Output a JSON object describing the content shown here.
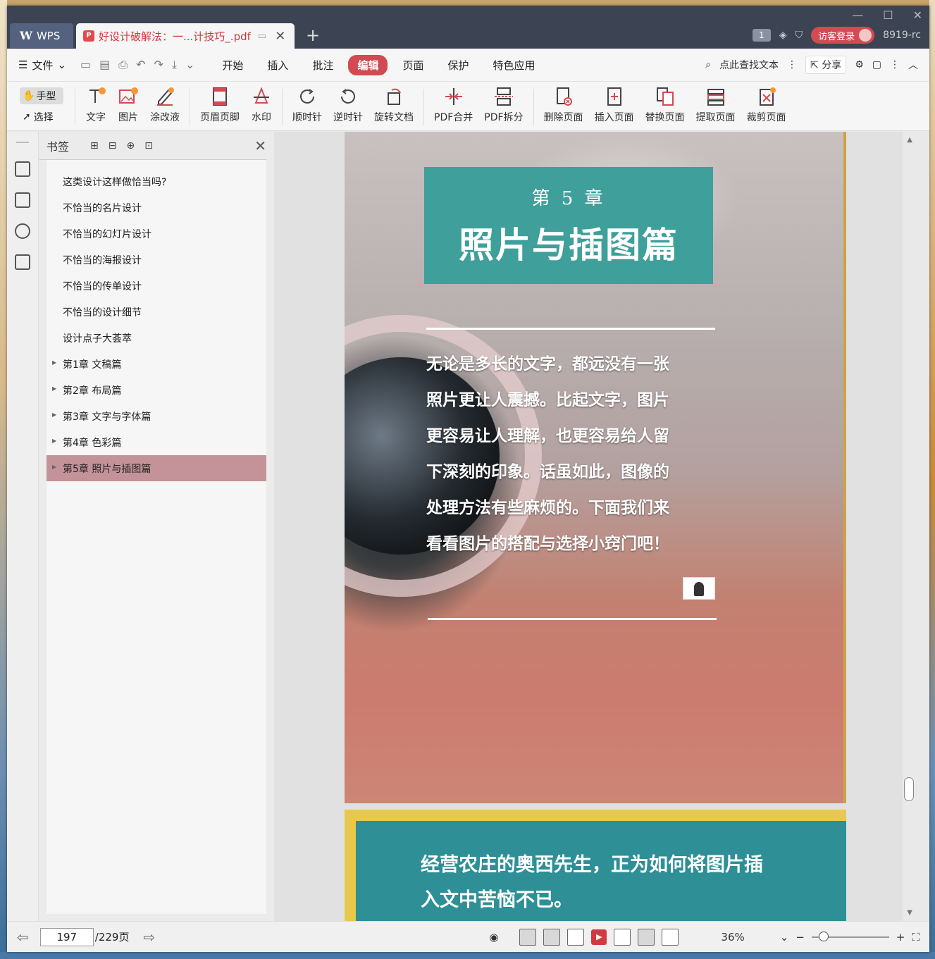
{
  "titlebar": {
    "app_tab": "WPS",
    "doc_tab": "好设计破解法：一...计技巧_.pdf",
    "login": "访客登录",
    "user_id": "8919-rc",
    "window_count": "1"
  },
  "menubar": {
    "file": "文件",
    "tabs": [
      "开始",
      "插入",
      "批注",
      "编辑",
      "页面",
      "保护",
      "特色应用"
    ],
    "active_tab": "编辑",
    "search": "点此查找文本",
    "share": "分享"
  },
  "ribbon": {
    "hand": "手型",
    "select": "选择",
    "tools": [
      "文字",
      "图片",
      "涂改液",
      "页眉页脚",
      "水印",
      "顺时针",
      "逆时针",
      "旋转文档",
      "PDF合并",
      "PDF拆分",
      "删除页面",
      "插入页面",
      "替换页面",
      "提取页面",
      "裁剪页面"
    ]
  },
  "bookmarks": {
    "title": "书签",
    "items": [
      {
        "label": "这类设计这样做恰当吗?",
        "expandable": false
      },
      {
        "label": "不恰当的名片设计",
        "expandable": false
      },
      {
        "label": "不恰当的幻灯片设计",
        "expandable": false
      },
      {
        "label": "不恰当的海报设计",
        "expandable": false
      },
      {
        "label": "不恰当的传单设计",
        "expandable": false
      },
      {
        "label": "不恰当的设计细节",
        "expandable": false
      },
      {
        "label": "设计点子大荟萃",
        "expandable": false
      },
      {
        "label": "第1章  文稿篇",
        "expandable": true
      },
      {
        "label": "第2章  布局篇",
        "expandable": true
      },
      {
        "label": "第3章  文字与字体篇",
        "expandable": true
      },
      {
        "label": "第4章  色彩篇",
        "expandable": true
      },
      {
        "label": "第5章  照片与插图篇",
        "expandable": true
      }
    ],
    "selected_index": 11
  },
  "page": {
    "chapter_num": "第 5 章",
    "chapter_title": "照片与插图篇",
    "intro_lines": [
      "无论是多长的文字，都远没有一张",
      "照片更让人震撼。比起文字，图片",
      "更容易让人理解，也更容易给人留",
      "下深刻的印象。话虽如此，图像的",
      "处理方法有些麻烦的。下面我们来",
      "看看图片的搭配与选择小窍门吧！"
    ],
    "next_page_lines": [
      "经营农庄的奥西先生，正为如何将图片插",
      "入文中苦恼不已。"
    ]
  },
  "status": {
    "current_page": "197",
    "total_pages": "/229页",
    "zoom": "36%"
  }
}
